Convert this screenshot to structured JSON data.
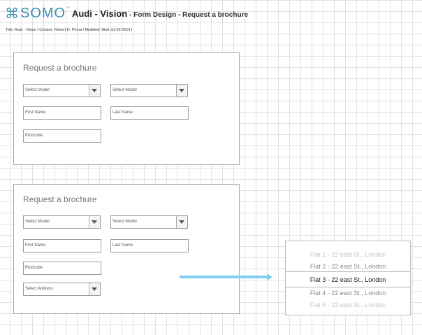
{
  "header": {
    "logo_mark": "⌘",
    "logo_text": "SOMO",
    "logo_tm": "™",
    "project": "Audi - Vision",
    "separator": " - ",
    "section": "Form Design - Request a brochure",
    "meta": "Title: Audi - Vision  I  Creator: Robert D. Pinna  I  Modified: Wed Jul 09 2014  I"
  },
  "panel1": {
    "title": "Request a brochure",
    "select_model_1": "Select Model",
    "select_model_2": "Select Model",
    "first_name": "First Name",
    "last_name": "Last Name",
    "postcode": "Postcode"
  },
  "panel2": {
    "title": "Request a brochure",
    "select_model_1": "Select Model",
    "select_model_2": "Select Model",
    "first_name": "First Name",
    "last_name": "Last Name",
    "postcode": "Postcode",
    "select_address": "Select Address"
  },
  "address_picker": {
    "options": [
      "Flat 1 - 22 east St., London",
      "Flat 2 - 22 east St., London",
      "Flat 3 - 22 east St., London",
      "Flat 4 - 22 east St., London",
      "Flat 5 - 22 east St., London"
    ],
    "selected_index": 2
  },
  "colors": {
    "brand": "#3d8fb5",
    "connector": "#7ecff0",
    "grid": "#e2e2e2"
  }
}
